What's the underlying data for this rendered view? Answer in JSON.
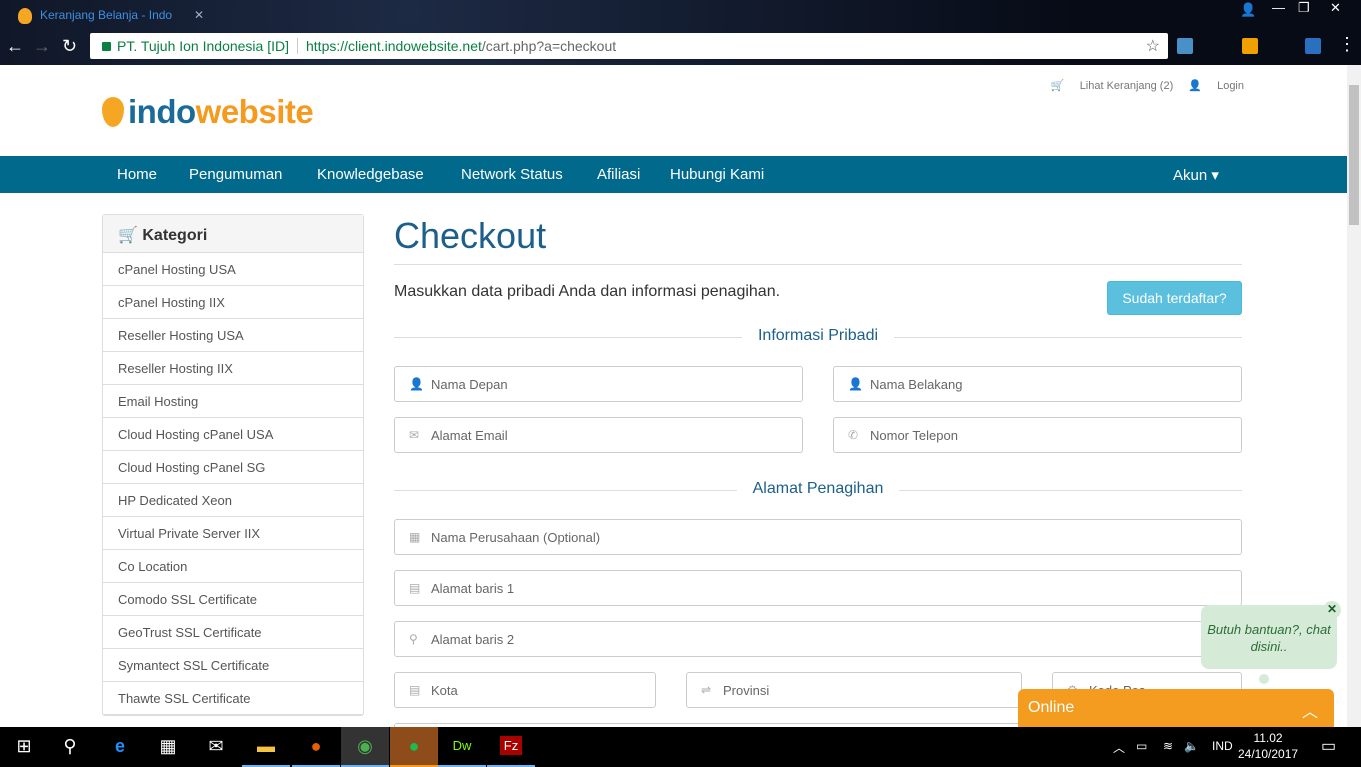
{
  "browser": {
    "tab_title": "Keranjang Belanja - Indo",
    "org": "PT. Tujuh Ion Indonesia [ID]",
    "url_host": "https://client.indowebsite.net",
    "url_path": "/cart.php?a=checkout"
  },
  "header": {
    "cart_link": "Lihat Keranjang (2)",
    "login_link": "Login",
    "logo_a": "indo",
    "logo_b": "website"
  },
  "nav": {
    "items": [
      "Home",
      "Pengumuman",
      "Knowledgebase",
      "Network Status",
      "Afiliasi",
      "Hubungi Kami"
    ],
    "account": "Akun"
  },
  "sidebar": {
    "title": "Kategori",
    "items": [
      "cPanel Hosting USA",
      "cPanel Hosting IIX",
      "Reseller Hosting USA",
      "Reseller Hosting IIX",
      "Email Hosting",
      "Cloud Hosting cPanel USA",
      "Cloud Hosting cPanel SG",
      "HP Dedicated Xeon",
      "Virtual Private Server IIX",
      "Co Location",
      "Comodo SSL Certificate",
      "GeoTrust SSL Certificate",
      "Symantect SSL Certificate",
      "Thawte SSL Certificate"
    ]
  },
  "main": {
    "title": "Checkout",
    "intro": "Masukkan data pribadi Anda dan informasi penagihan.",
    "already_registered": "Sudah terdaftar?",
    "section_personal": "Informasi Pribadi",
    "section_billing": "Alamat Penagihan",
    "fields": {
      "first_name": "Nama Depan",
      "last_name": "Nama Belakang",
      "email": "Alamat Email",
      "phone": "Nomor Telepon",
      "company": "Nama Perusahaan (Optional)",
      "address1": "Alamat baris 1",
      "address2": "Alamat baris 2",
      "city": "Kota",
      "state": "Provinsi",
      "postcode": "Kode Pos"
    }
  },
  "chat": {
    "bubble": "Butuh bantuan?, chat disini..",
    "status": "Online"
  },
  "taskbar": {
    "lang": "IND",
    "time": "11.02",
    "date": "24/10/2017"
  },
  "colors": {
    "nav": "#00698c",
    "chat": "#f39c1f",
    "button": "#5bc0de"
  }
}
